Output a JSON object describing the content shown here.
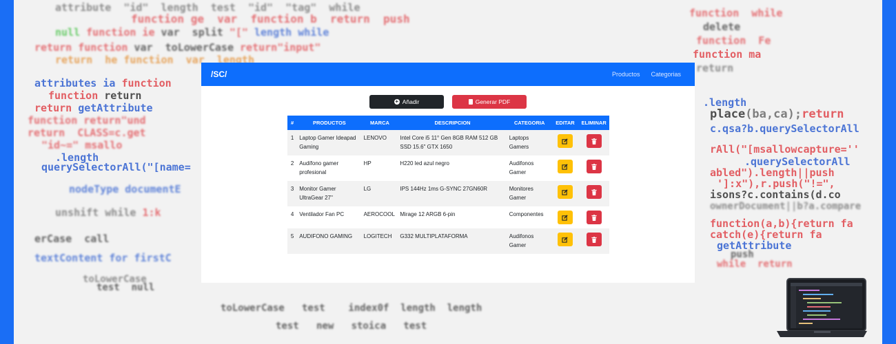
{
  "brand": "/SC/",
  "nav": {
    "productos": "Productos",
    "categorias": "Categorias"
  },
  "actions": {
    "add_label": "Añadir",
    "pdf_label": "Generar PDF"
  },
  "table": {
    "headers": [
      "#",
      "PRODUCTOS",
      "MARCA",
      "DESCRIPCION",
      "CATEGORIA",
      "EDITAR",
      "ELIMINAR"
    ],
    "rows": [
      {
        "id": "1",
        "producto": "Laptop Gamer Ideapad Gaming",
        "marca": "LENOVO",
        "descripcion": "Intel Core i5 11° Gen 8GB RAM 512 GB SSD 15.6\" GTX 1650",
        "categoria": "Laptops Gamers"
      },
      {
        "id": "2",
        "producto": "Audífono gamer profesional",
        "marca": "HP",
        "descripcion": "H220 led azul negro",
        "categoria": "Audifonos Gamer"
      },
      {
        "id": "3",
        "producto": "Monitor Gamer UltraGear 27''",
        "marca": "LG",
        "descripcion": "IPS 144Hz 1ms G-SYNC 27GN60R",
        "categoria": "Monitores Gamer"
      },
      {
        "id": "4",
        "producto": "Ventilador Fan PC",
        "marca": "AEROCOOL",
        "descripcion": "Mirage 12 ARGB 6-pin",
        "categoria": "Componentes"
      },
      {
        "id": "5",
        "producto": "AUDIFONO GAMING",
        "marca": "LOGITECH",
        "descripcion": "G332 MULTIPLATAFORMA",
        "categoria": "Audifonos Gamer"
      }
    ]
  },
  "colors": {
    "accent": "#0d6efd",
    "danger": "#dc3545",
    "warning": "#ffc107",
    "dark": "#212529"
  }
}
